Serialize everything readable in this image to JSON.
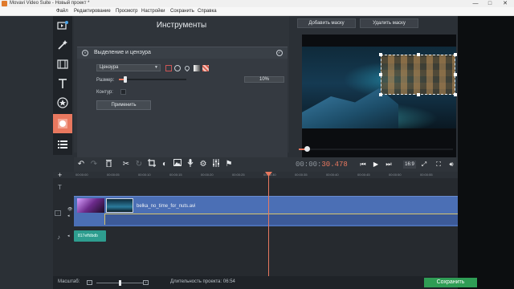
{
  "window": {
    "title": "Movavi Video Suite - Новый проект *",
    "minimize": "—",
    "maximize": "□",
    "close": "✕"
  },
  "menu": [
    "Файл",
    "Редактирование",
    "Просмотр",
    "Настройки",
    "Сохранить",
    "Справка"
  ],
  "tools_panel": {
    "title": "Инструменты",
    "sub_title": "Выделение и цензура",
    "mode_select": "Цензура",
    "size_label": "Размер:",
    "size_value": "10%",
    "size_level": 0.1,
    "contour_label": "Контур:",
    "apply_label": "Применить"
  },
  "preview": {
    "add_mask": "Добавить маску",
    "remove_mask": "Удалить маску",
    "progress": 0.05
  },
  "toolbar": {
    "timecode_grey": "00:00:",
    "timecode_accent": "30.478",
    "aspect_ratio": "16:9"
  },
  "timeline": {
    "ruler_ticks": [
      "00:00:00",
      "00:00:05",
      "00:00:10",
      "00:00:15",
      "00:00:20",
      "00:00:25",
      "00:00:30",
      "00:00:35",
      "00:00:40",
      "00:00:45",
      "00:00:50",
      "00:00:55"
    ],
    "clip_name": "belka_no_time_for_nuts.avi",
    "audio_clip": "817effdbdb"
  },
  "statusbar": {
    "zoom_label": "Масштаб:",
    "duration": "Длительность проекта: 06:54",
    "save_label": "Сохранить"
  },
  "colors": {
    "accent": "#e8785f",
    "save_green": "#2f9d55",
    "video_track": "#4b6fb5",
    "audio_track": "#2e9d8f"
  },
  "icons": {
    "tools": [
      "import-icon",
      "magic-wand-icon",
      "film-strip-icon",
      "text-icon",
      "star-icon",
      "circle-mask-icon",
      "list-icon"
    ]
  }
}
